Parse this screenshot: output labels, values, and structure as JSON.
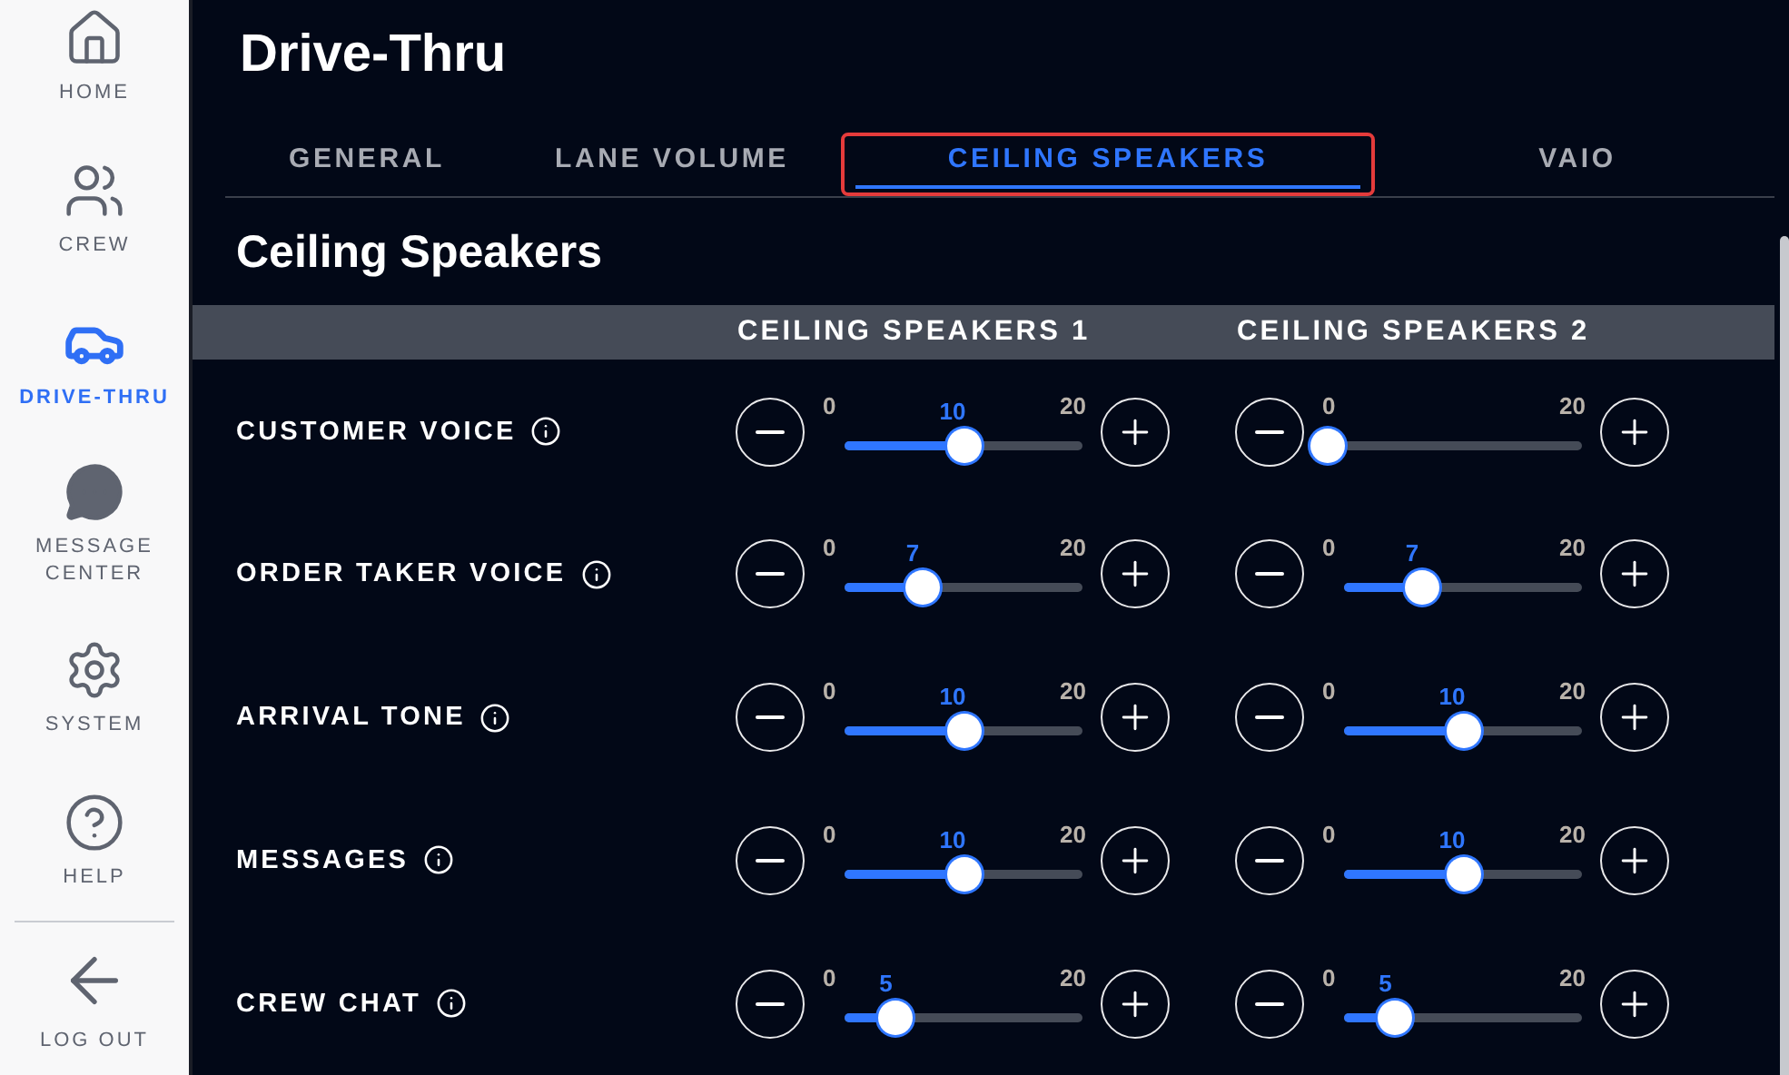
{
  "sidebar": {
    "items": [
      {
        "kind": "home",
        "label": "HOME",
        "selected": false
      },
      {
        "kind": "crew",
        "label": "CREW",
        "selected": false
      },
      {
        "kind": "drive",
        "label": "DRIVE-THRU",
        "selected": true
      },
      {
        "kind": "message",
        "label": "MESSAGE CENTER",
        "selected": false
      },
      {
        "kind": "system",
        "label": "SYSTEM",
        "selected": false
      },
      {
        "kind": "help",
        "label": "HELP",
        "selected": false
      }
    ],
    "logout": {
      "label": "LOG OUT"
    }
  },
  "page_title": "Drive-Thru",
  "tabs": [
    {
      "label": "GENERAL",
      "selected": false,
      "highlighted": false
    },
    {
      "label": "LANE VOLUME",
      "selected": false,
      "highlighted": false
    },
    {
      "label": "CEILING SPEAKERS",
      "selected": true,
      "highlighted": true
    },
    {
      "label": "VAIO",
      "selected": false,
      "highlighted": false
    }
  ],
  "section_title": "Ceiling Speakers",
  "columns": [
    "CEILING SPEAKERS 1",
    "CEILING SPEAKERS 2"
  ],
  "rows": [
    {
      "label": "CUSTOMER VOICE",
      "controls": [
        {
          "min": "0",
          "max": "20",
          "value": "10",
          "level": 0.5
        },
        {
          "min": "0",
          "max": "20",
          "level": 0
        }
      ]
    },
    {
      "label": "ORDER TAKER VOICE",
      "controls": [
        {
          "min": "0",
          "max": "20",
          "value": "7",
          "level": 0.35
        },
        {
          "min": "0",
          "max": "20",
          "value": "7",
          "level": 0.35
        }
      ]
    },
    {
      "label": "ARRIVAL TONE",
      "controls": [
        {
          "min": "0",
          "max": "20",
          "value": "10",
          "level": 0.5
        },
        {
          "min": "0",
          "max": "20",
          "value": "10",
          "level": 0.5
        }
      ]
    },
    {
      "label": "MESSAGES",
      "controls": [
        {
          "min": "0",
          "max": "20",
          "value": "10",
          "level": 0.5
        },
        {
          "min": "0",
          "max": "20",
          "value": "10",
          "level": 0.5
        }
      ]
    },
    {
      "label": "CREW CHAT",
      "controls": [
        {
          "min": "0",
          "max": "20",
          "value": "5",
          "level": 0.25
        },
        {
          "min": "0",
          "max": "20",
          "value": "5",
          "level": 0.25
        }
      ]
    }
  ]
}
